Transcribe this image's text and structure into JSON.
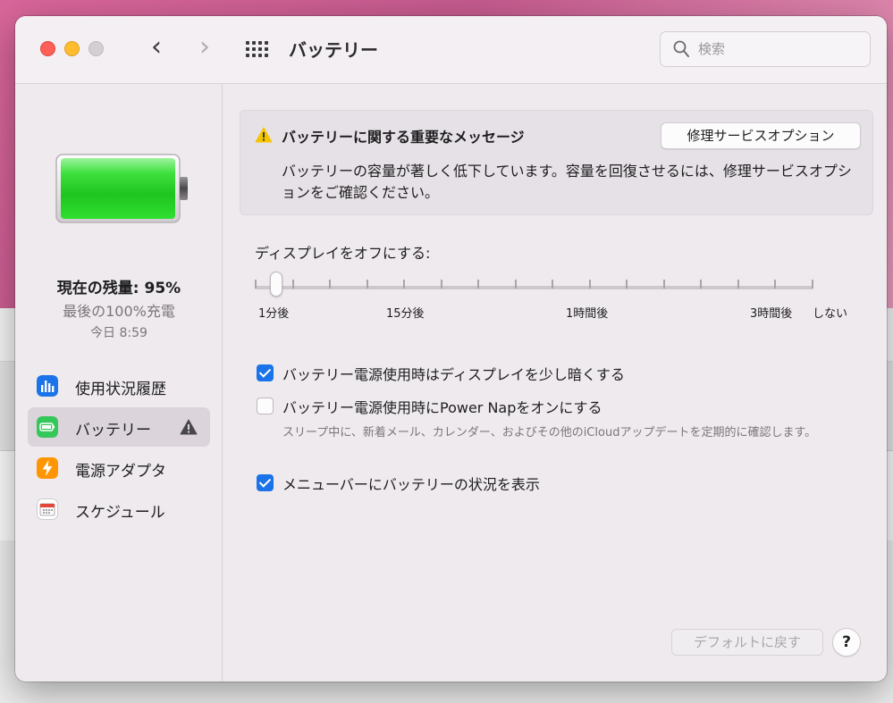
{
  "window": {
    "title": "バッテリー",
    "search_placeholder": "検索"
  },
  "sidebar": {
    "charge_level": "現在の残量: 95%",
    "last_charged": "最後の100%充電",
    "charged_time": "今日 8:59",
    "items": [
      {
        "label": "使用状況履歴",
        "icon": "bar-chart-icon",
        "color": "#1a73e8"
      },
      {
        "label": "バッテリー",
        "icon": "battery-icon",
        "color": "#34c759",
        "selected": true,
        "warning": true
      },
      {
        "label": "電源アダプタ",
        "icon": "lightning-icon",
        "color": "#ff9500"
      },
      {
        "label": "スケジュール",
        "icon": "calendar-icon",
        "color": "#ffffff"
      }
    ]
  },
  "alert": {
    "title": "バッテリーに関する重要なメッセージ",
    "button": "修理サービスオプション",
    "body": "バッテリーの容量が著しく低下しています。容量を回復させるには、修理サービスオプションをご確認ください。"
  },
  "display_off": {
    "label": "ディスプレイをオフにする:",
    "ticks": [
      "1分後",
      "15分後",
      "1時間後",
      "3時間後",
      "しない"
    ],
    "value": "1分後"
  },
  "options": [
    {
      "label": "バッテリー電源使用時はディスプレイを少し暗くする",
      "checked": true
    },
    {
      "label": "バッテリー電源使用時にPower Napをオンにする",
      "checked": false,
      "description": "スリープ中に、新着メール、カレンダー、およびその他のiCloudアップデートを定期的に確認します。"
    },
    {
      "label": "メニューバーにバッテリーの状況を表示",
      "checked": true
    }
  ],
  "footer": {
    "default_button": "デフォルトに戻す",
    "help_button": "?"
  },
  "colors": {
    "accent": "#1a73e8",
    "warning": "#f5c400",
    "battery_green": "#2ed42e"
  }
}
